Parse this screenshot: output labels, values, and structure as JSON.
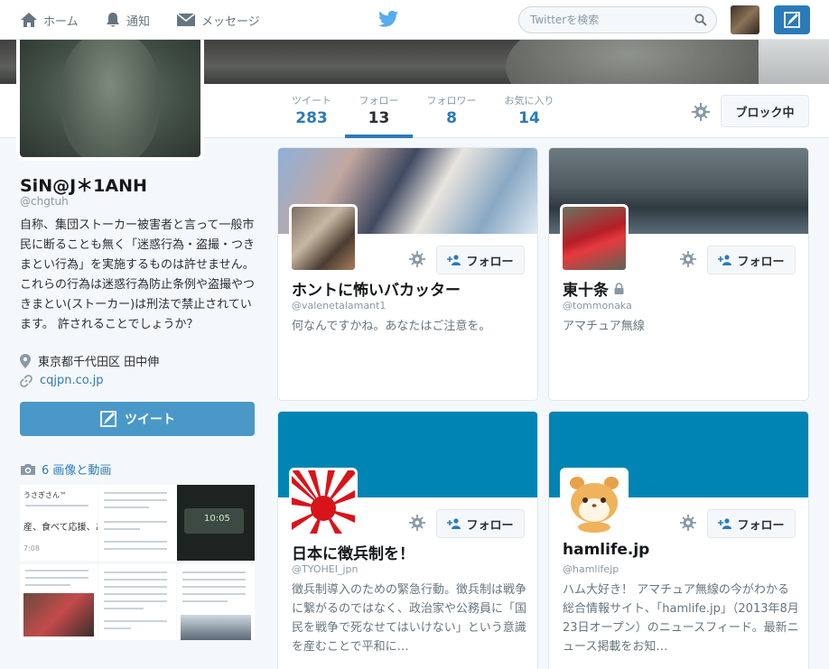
{
  "nav": {
    "home_label": "ホーム",
    "notifications_label": "通知",
    "messages_label": "メッセージ",
    "search_placeholder": "Twitterを検索"
  },
  "profile": {
    "name": "SiN@J＊1ANH",
    "handle": "@chgtuh",
    "bio": "自称、集団ストーカー被害者と言って一般市民に断ることも無く「迷惑行為・盗撮・つきまとい行為」を実施するものは許せません。 これらの行為は迷惑行為防止条例や盗撮やつきまとい(ストーカー)は刑法で禁止されています。 許されることでしょうか？",
    "location": "東京都千代田区 田中伸",
    "url": "cqjpn.co.jp",
    "tweet_button": "ツイート",
    "media_label": "6 画像と動画"
  },
  "stats": {
    "tweets_label": "ツイート",
    "tweets_value": "283",
    "following_label": "フォロー",
    "following_value": "13",
    "followers_label": "フォロワー",
    "followers_value": "8",
    "favorites_label": "お気に入り",
    "favorites_value": "14",
    "block_button": "ブロック中"
  },
  "media_thumbs": {
    "t1_line1": "うさぎさん™",
    "t1_line2": "産、食べて応援、あ",
    "t1_line3": "7:08",
    "t3_text": "10:05"
  },
  "cards": [
    {
      "name": "ホントに怖いバカッター",
      "handle": "@valenetalamant1",
      "bio": "何なんですかね。あなたはご注意を。",
      "follow": "フォロー",
      "protected": false
    },
    {
      "name": "東十条",
      "handle": "@tommonaka",
      "bio": "アマチュア無線",
      "follow": "フォロー",
      "protected": true
    },
    {
      "name": "日本に徴兵制を！",
      "handle": "@TYOHEI_jpn",
      "bio": "徴兵制導入のための緊急行動。徴兵制は戦争に繋がるのではなく、政治家や公務員に「国民を戦争で死なせてはいけない」という意識を産むことで平和に…",
      "follow": "フォロー",
      "protected": false
    },
    {
      "name": "hamlife.jp",
      "handle": "@hamlifejp",
      "bio": "ハム大好き！ アマチュア無線の今がわかる総合情報サイト、「hamlife.jp」（2013年8月23日オープン）のニュースフィード。最新ニュース掲載をお知…",
      "follow": "フォロー",
      "protected": false
    }
  ],
  "colors": {
    "accent": "#2b7bb9",
    "tweet_button": "#4a98c7",
    "card_banner_blue": "#0084b4"
  },
  "icons": [
    "home-icon",
    "bell-icon",
    "envelope-icon",
    "twitter-bird-icon",
    "search-icon",
    "compose-icon",
    "gear-icon",
    "location-pin-icon",
    "link-icon",
    "camera-icon",
    "follow-person-icon",
    "lock-icon"
  ]
}
